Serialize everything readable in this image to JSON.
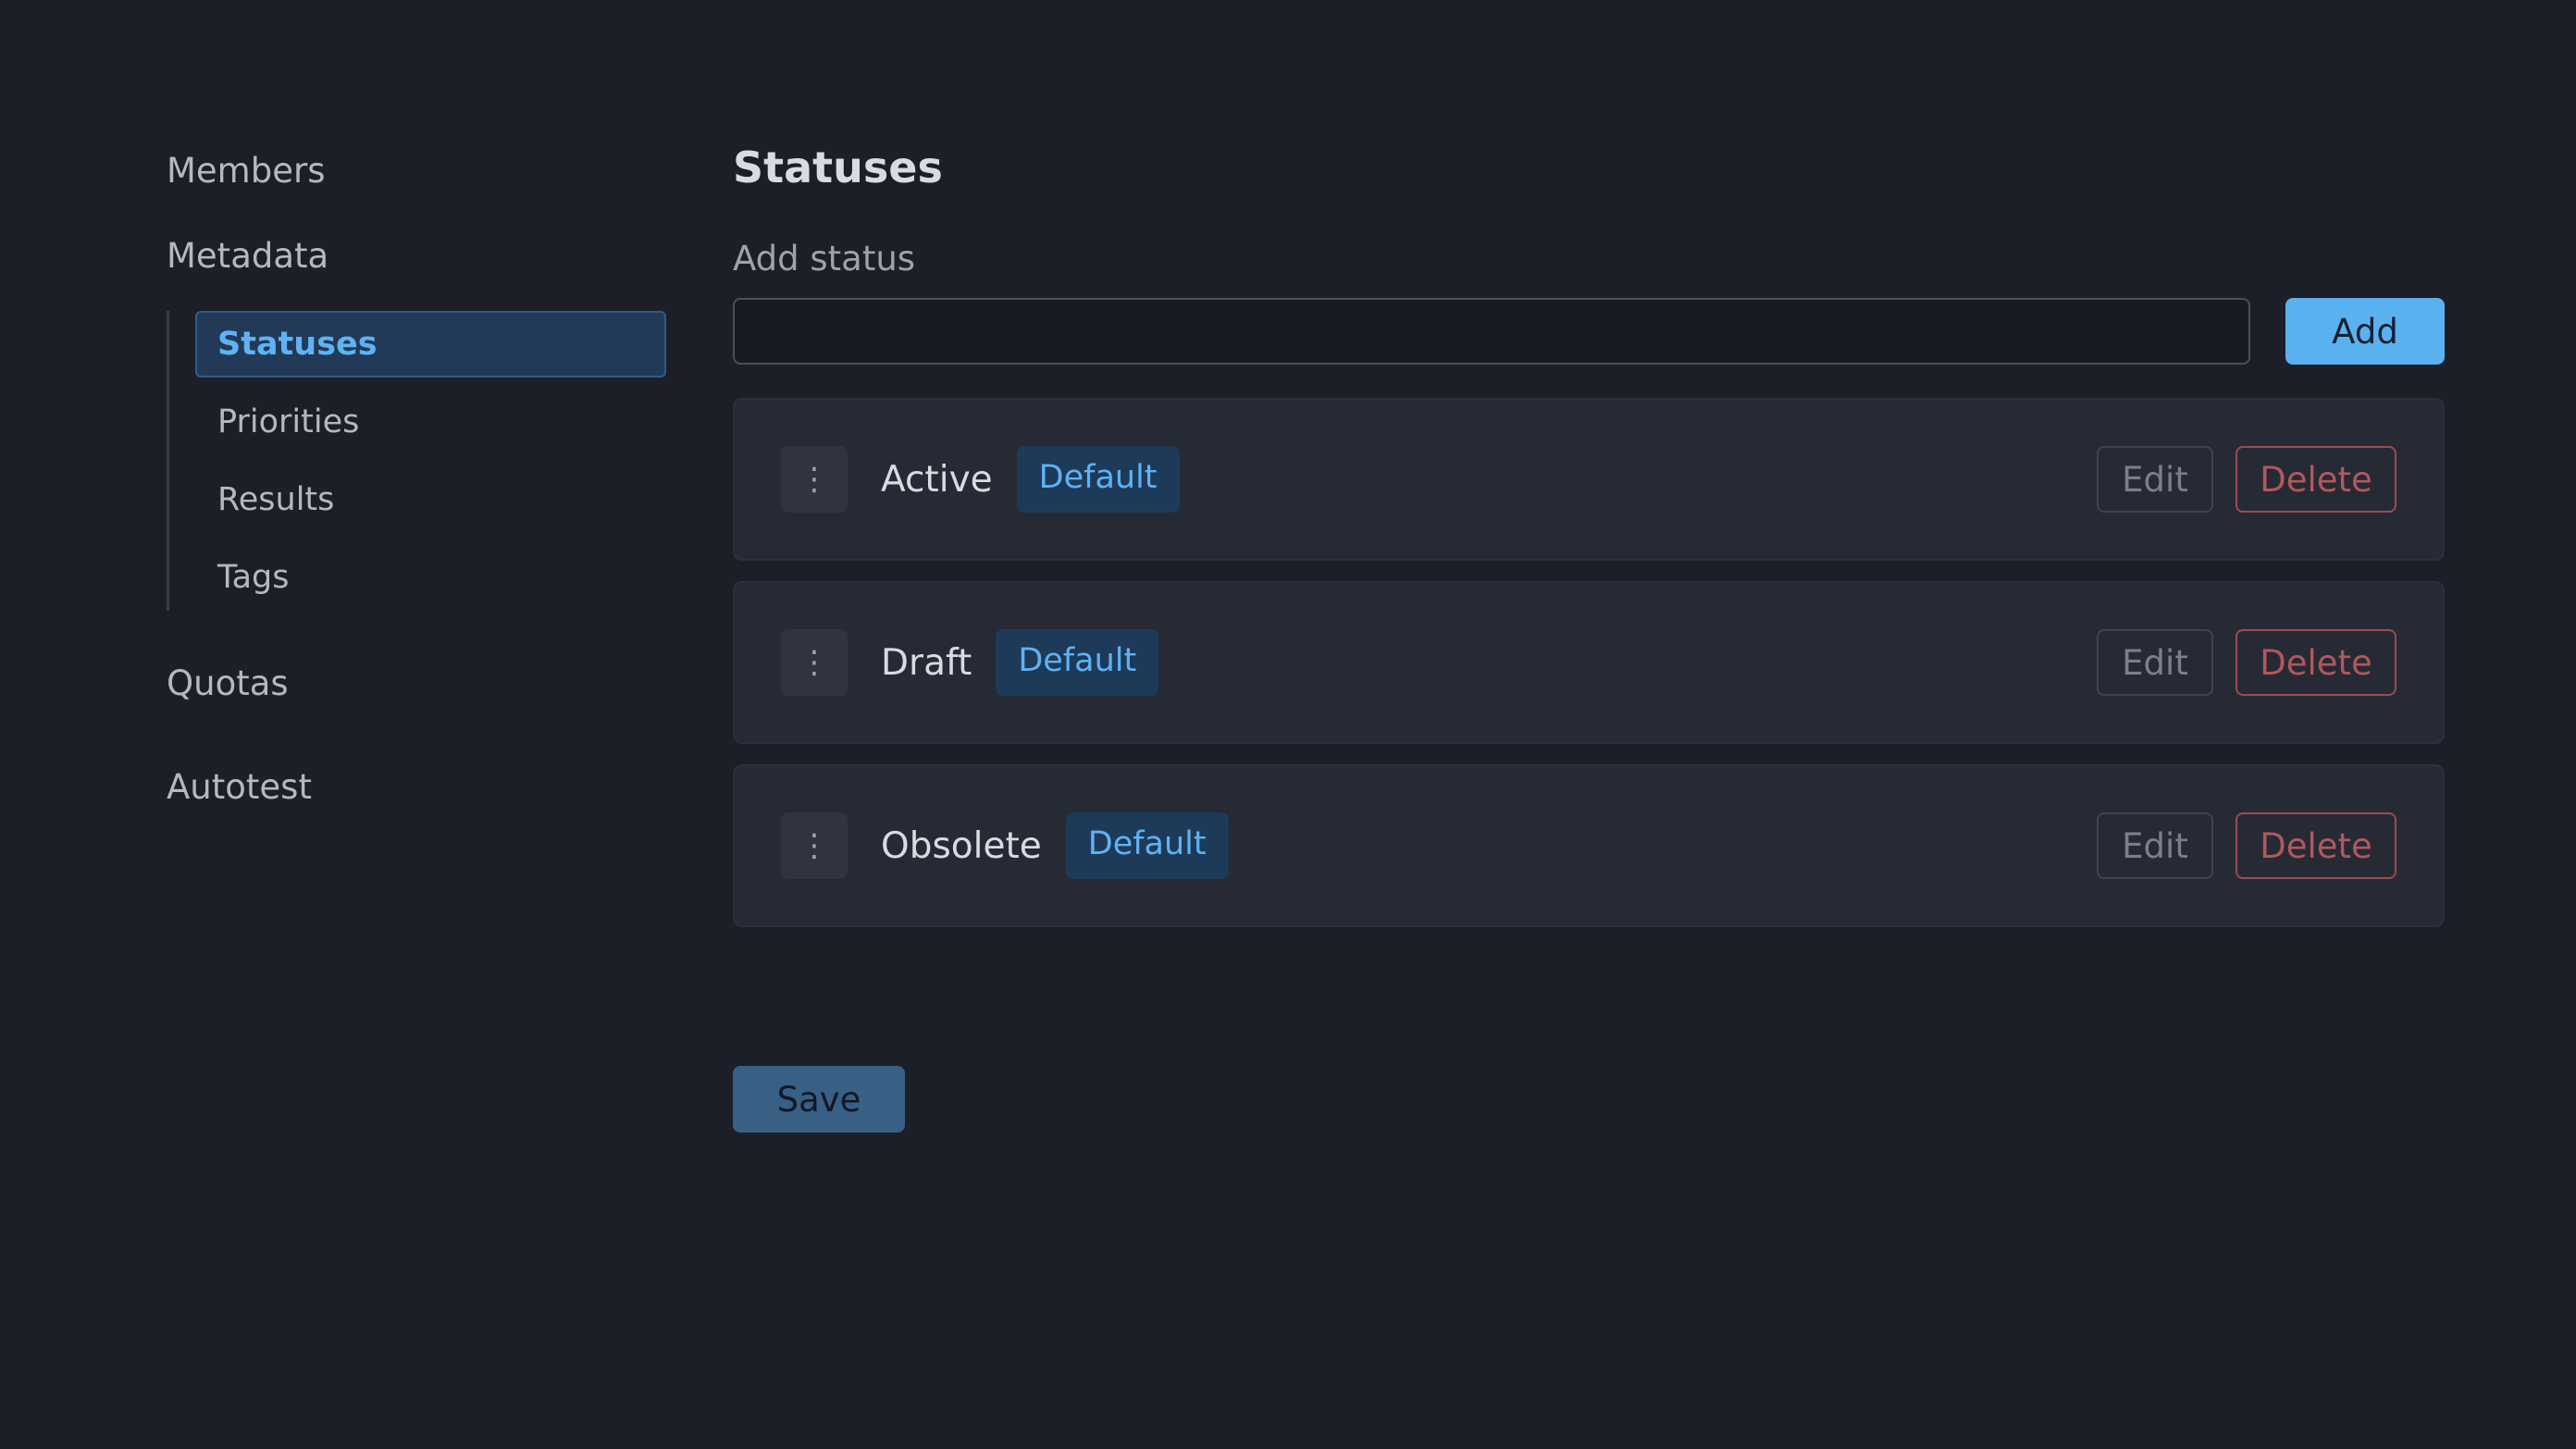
{
  "sidebar": {
    "members": "Members",
    "metadata": "Metadata",
    "metadata_items": [
      "Statuses",
      "Priorities",
      "Results",
      "Tags"
    ],
    "quotas": "Quotas",
    "autotest": "Autotest",
    "active_item": "Statuses"
  },
  "main": {
    "title": "Statuses",
    "add_label": "Add status",
    "add_input_value": "",
    "add_button": "Add",
    "statuses": [
      {
        "name": "Active",
        "badge": "Default",
        "edit": "Edit",
        "delete": "Delete"
      },
      {
        "name": "Draft",
        "badge": "Default",
        "edit": "Edit",
        "delete": "Delete"
      },
      {
        "name": "Obsolete",
        "badge": "Default",
        "edit": "Edit",
        "delete": "Delete"
      }
    ],
    "save_button": "Save"
  },
  "icons": {
    "drag_handle": "vertical-ellipsis-icon"
  },
  "colors": {
    "background": "#1c1f27",
    "accent": "#5ab1ef",
    "danger": "#b1585c",
    "card": "#262a34"
  }
}
